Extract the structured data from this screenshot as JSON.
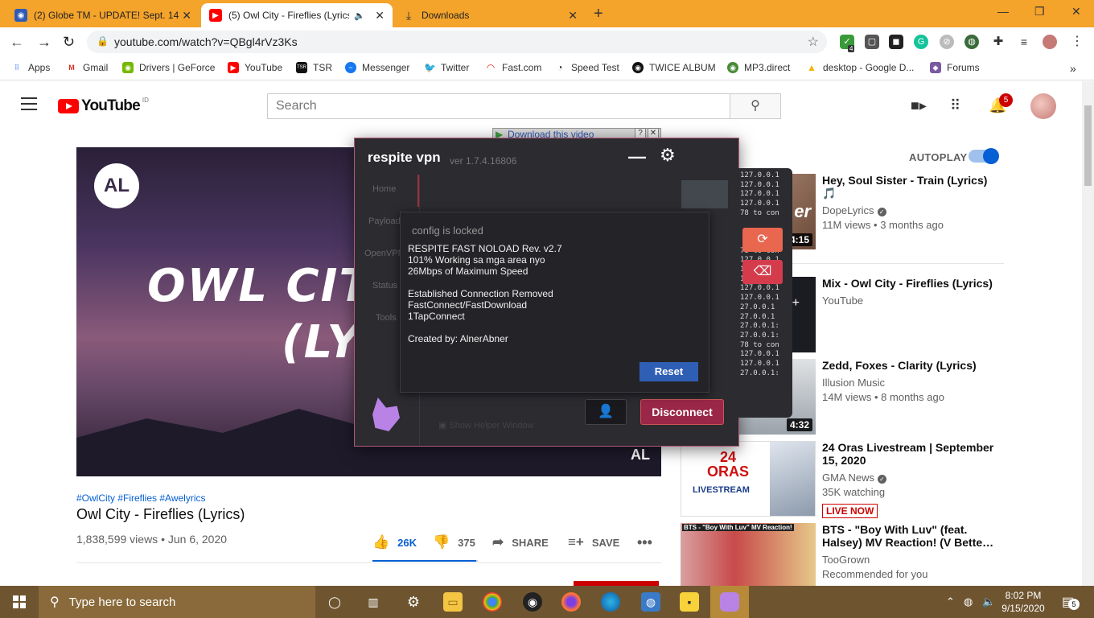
{
  "browser": {
    "tabs": [
      {
        "label": "(2) Globe TM - UPDATE! Sept. 14",
        "close": "✕"
      },
      {
        "label": "(5) Owl City - Fireflies (Lyrics)",
        "close": "✕"
      },
      {
        "label": "Downloads",
        "close": "✕"
      }
    ],
    "new_tab": "+",
    "url": "youtube.com/watch?v=QBgl4rVz3Ks",
    "bookmarks": [
      "Apps",
      "Gmail",
      "Drivers | GeForce",
      "YouTube",
      "TSR",
      "Messenger",
      "Twitter",
      "Fast.com",
      "Speed Test",
      "TWICE ALBUM",
      "MP3.direct",
      "desktop - Google D...",
      "Forums"
    ],
    "extension_badge": "4",
    "more": "»"
  },
  "youtube": {
    "logo_text": "YouTube",
    "region": "ID",
    "search_placeholder": "Search",
    "notification_count": "5",
    "video_overlay": {
      "title_line1": "OWL CITY",
      "title_line2": "(LY",
      "logo": "AL",
      "corner_logo": "AL"
    },
    "download_bar": {
      "label": "Download this video",
      "help": "?",
      "close": "✕"
    },
    "tags": "#OwlCity #Fireflies #Awelyrics",
    "title": "Owl City - Fireflies (Lyrics)",
    "stats": "1,838,599 views • Jun 6, 2020",
    "likes": "26K",
    "dislikes": "375",
    "share": "SHARE",
    "save": "SAVE",
    "like_ratio": 0.986,
    "autoplay_label": "AUTOPLAY",
    "recommendations": [
      {
        "title": "Hey, Soul Sister - Train (Lyrics) 🎵",
        "channel": "DopeLyrics",
        "meta": "11M views • 3 months ago",
        "duration": "4:15",
        "thumb_text": "er"
      },
      {
        "title": "Mix - Owl City - Fireflies (Lyrics)",
        "channel": "YouTube",
        "meta": "",
        "duration": "",
        "thumb_text": "+"
      },
      {
        "title": "Zedd, Foxes - Clarity (Lyrics)",
        "channel": "Illusion Music",
        "meta": "14M views • 8 months ago",
        "duration": "4:32",
        "thumb_text": ""
      },
      {
        "title": "24 Oras Livestream | September 15, 2020",
        "channel": "GMA News",
        "meta": "35K watching",
        "badge": "LIVE NOW",
        "thumb_text": "24 ORAS",
        "thumb_sub": "LIVESTREAM"
      },
      {
        "title": "BTS - \"Boy With Luv\" (feat. Halsey) MV Reaction! (V Bette…",
        "channel": "TooGrown",
        "meta": "Recommended for you",
        "thumb_text": "BTS - \"Boy With Luv\" MV Reaction!"
      }
    ]
  },
  "vpn": {
    "title": "respite vpn",
    "version": "ver 1.7.4.16806",
    "minimize": "—",
    "sidebar": [
      "Home",
      "Payload",
      "OpenVPN",
      "Status",
      "Tools"
    ],
    "helper": "Show Helper Window",
    "disconnect": "Disconnect",
    "dialog": {
      "title": "config is locked",
      "lines": [
        "RESPITE FAST NOLOAD Rev. v2.7",
        "101% Working sa mga area nyo",
        "26Mbps of Maximum Speed",
        "",
        "Established Connection Removed",
        "FastConnect/FastDownload",
        "1TapConnect",
        "",
        "Created by: AlnerAbner"
      ],
      "reset": "Reset"
    },
    "log": [
      "127.0.0.1",
      "127.0.0.1",
      "127.0.0.1",
      "127.0.0.1",
      "78 to con",
      "",
      "",
      "",
      "78 to con",
      "127.0.0.1",
      "127.0.0.1",
      "127.0.0.1",
      "127.0.0.1",
      "127.0.0.1",
      "27.0.0.1",
      "27.0.0.1",
      "27.0.0.1:",
      "27.0.0.1:",
      "78 to con",
      "127.0.0.1",
      "127.0.0.1",
      "27.0.0.1:"
    ]
  },
  "taskbar": {
    "search_placeholder": "Type here to search",
    "time": "8:02 PM",
    "date": "9/15/2020",
    "notification_count": "5"
  }
}
